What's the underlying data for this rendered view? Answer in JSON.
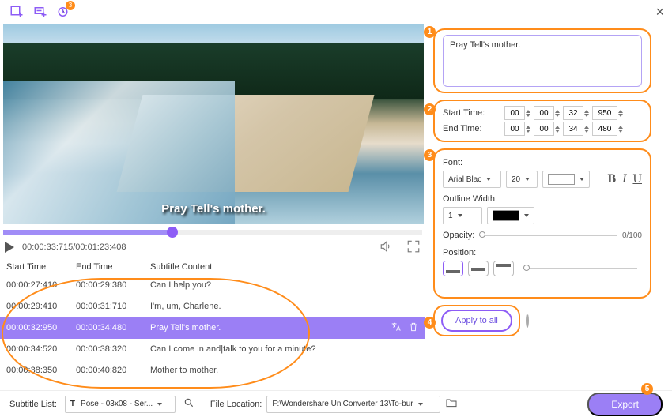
{
  "toolbar": {
    "badge": "3"
  },
  "preview": {
    "overlay_subtitle": "Pray Tell's mother.",
    "time_display": "00:00:33:715/00:01:23:408"
  },
  "list_header": {
    "start": "Start Time",
    "end": "End Time",
    "content": "Subtitle Content"
  },
  "subtitles": [
    {
      "start": "00:00:27:410",
      "end": "00:00:29:380",
      "content": "Can I help you?"
    },
    {
      "start": "00:00:29:410",
      "end": "00:00:31:710",
      "content": "I'm, um, Charlene."
    },
    {
      "start": "00:00:32:950",
      "end": "00:00:34:480",
      "content": "Pray Tell's mother."
    },
    {
      "start": "00:00:34:520",
      "end": "00:00:38:320",
      "content": "Can I come in and|talk to you for a minute?"
    },
    {
      "start": "00:00:38:350",
      "end": "00:00:40:820",
      "content": "Mother to mother."
    }
  ],
  "editor": {
    "text": "Pray Tell's mother.",
    "start_label": "Start Time:",
    "end_label": "End Time:",
    "start": {
      "h": "00",
      "m": "00",
      "s": "32",
      "ms": "950"
    },
    "end": {
      "h": "00",
      "m": "00",
      "s": "34",
      "ms": "480"
    },
    "font_label": "Font:",
    "font_name": "Arial Blac",
    "font_size": "20",
    "outline_label": "Outline Width:",
    "outline_width": "1",
    "opacity_label": "Opacity:",
    "opacity_value": "0/100",
    "position_label": "Position:",
    "apply_label": "Apply to all"
  },
  "bottom": {
    "sublist_label": "Subtitle List:",
    "sublist_value": "Pose - 03x08 - Ser...",
    "fileloc_label": "File Location:",
    "fileloc_value": "F:\\Wondershare UniConverter 13\\To-bur",
    "export_label": "Export"
  },
  "steps": {
    "s1": "1",
    "s2": "2",
    "s3": "3",
    "s4": "4",
    "s5": "5"
  }
}
